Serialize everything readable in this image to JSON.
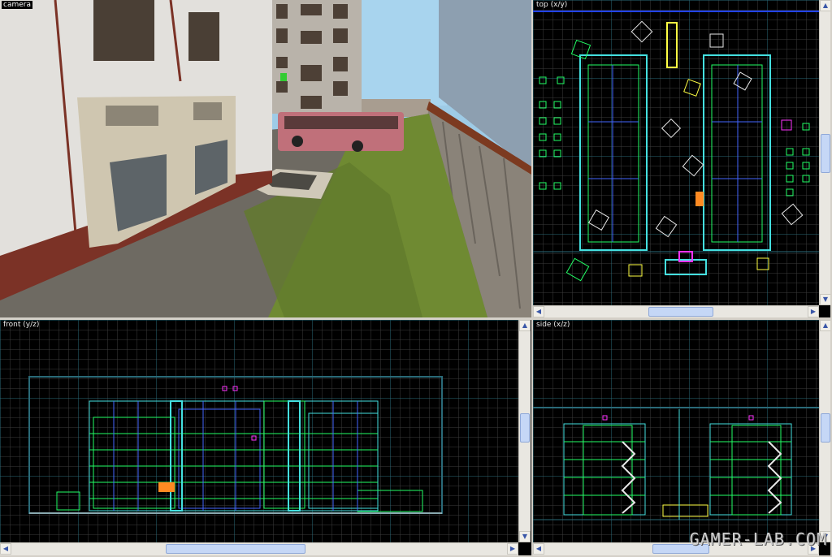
{
  "viewports": {
    "camera": {
      "label": "camera"
    },
    "top": {
      "label": "top (x/y)"
    },
    "front": {
      "label": "front (y/z)"
    },
    "side": {
      "label": "side (x/z)"
    }
  },
  "scrollbars": {
    "up_arrow": "▲",
    "down_arrow": "▼",
    "left_arrow": "◀",
    "right_arrow": "▶"
  },
  "watermark": "GAMER-LAB.COM",
  "colors": {
    "viewport_bg": "#000000",
    "grid_minor": "#3c3c3c",
    "grid_major": "#2a6a78",
    "brush_green": "#22ff66",
    "brush_cyan": "#44e0e0",
    "brush_blue": "#4466ff",
    "entity_magenta": "#ff33ff",
    "entity_yellow": "#ffff44",
    "entity_orange": "#ff8a22",
    "selection_blue": "#2244ff"
  }
}
